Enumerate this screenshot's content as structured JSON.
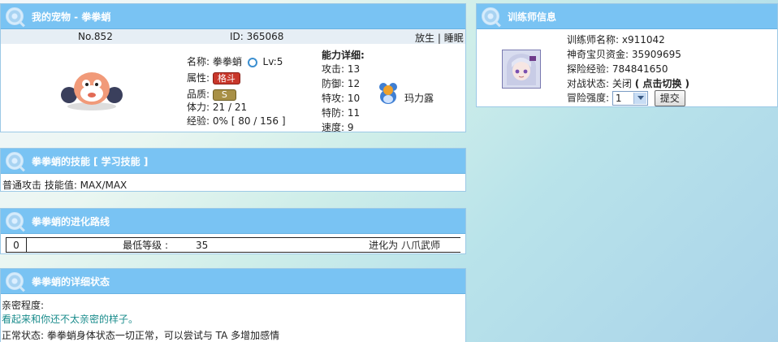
{
  "pet": {
    "header": "我的宠物 - 拳拳蛸",
    "no": "No.852",
    "id": "ID: 365068",
    "action_release": "放生",
    "separator": "|",
    "action_sleep": "睡眠",
    "name_label": "名称:",
    "name": "拳拳蛸",
    "level": "Lv:5",
    "attr_label": "属性:",
    "attr": "格斗",
    "quality_label": "品质:",
    "quality": "S",
    "hp_label": "体力:",
    "hp": "21 / 21",
    "exp_label": "经验:",
    "exp": "0% [ 80 / 156 ]",
    "stats_title": "能力详细:",
    "stats": [
      {
        "label": "攻击:",
        "value": "13"
      },
      {
        "label": "防御:",
        "value": "12"
      },
      {
        "label": "特攻:",
        "value": "10"
      },
      {
        "label": "特防:",
        "value": "11"
      },
      {
        "label": "速度:",
        "value": "9"
      }
    ],
    "trainer_pet_name": "玛力露"
  },
  "skills": {
    "header": "拳拳蛸的技能",
    "learn_link": "[ 学习技能 ]",
    "item": "普通攻击 技能值: MAX/MAX"
  },
  "evolution": {
    "header": "拳拳蛸的进化路线",
    "row": {
      "idx": "0",
      "label": "最低等级 :",
      "level": "35",
      "target": "进化为 八爪武师"
    }
  },
  "status": {
    "header": "拳拳蛸的详细状态",
    "intimacy_label": "亲密程度:",
    "intimacy_text": "看起来和你还不太亲密的样子。",
    "normal_text": "正常状态: 拳拳蛸身体状态一切正常，可以尝试与 TA 多增加感情"
  },
  "trainer": {
    "header": "训练师信息",
    "name": "训练师名称: x911042",
    "money": "神奇宝贝资金: 35909695",
    "exp": "探险经验: 784841650",
    "battle_label": "对战状态:",
    "battle_value": "关闭",
    "battle_toggle": "( 点击切换 )",
    "adv_label": "冒险强度:",
    "adv_value": "1",
    "submit": "提交"
  },
  "colors": {
    "header": "#79c3f3",
    "type_badge": "#c8372b",
    "quality_badge": "#a89046",
    "teal_text": "#1a8c8c"
  }
}
